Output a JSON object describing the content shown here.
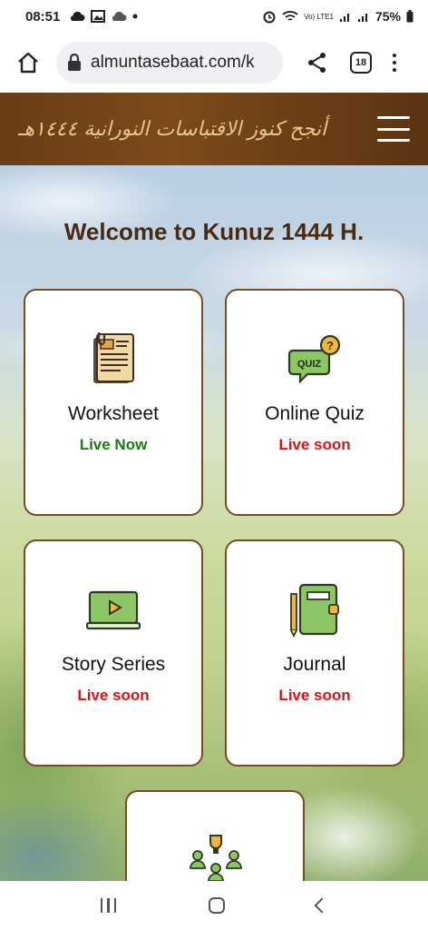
{
  "status_bar": {
    "time": "08:51",
    "battery": "75%",
    "network": "Vo) LTE1",
    "icons": [
      "cloud-icon",
      "image-icon",
      "cloud-icon",
      "dot-icon",
      "alarm-icon",
      "wifi-icon",
      "signal-icon",
      "signal-icon",
      "battery-icon"
    ]
  },
  "browser": {
    "url": "almuntasebaat.com/k",
    "tab_count": "18"
  },
  "site": {
    "logo_text": "أنجح كنوز الاقتباسات النورانية ١٤٤٤هـ",
    "welcome": "Welcome to Kunuz 1444 H."
  },
  "cards": [
    {
      "title": "Worksheet",
      "status": "Live Now",
      "icon": "worksheet-icon"
    },
    {
      "title": "Online Quiz",
      "status": "Live soon",
      "icon": "quiz-icon"
    },
    {
      "title": "Story Series",
      "status": "Live soon",
      "icon": "video-icon"
    },
    {
      "title": "Journal",
      "status": "Live soon",
      "icon": "journal-icon"
    }
  ],
  "colors": {
    "header_brown": "#6a3d17",
    "title_brown": "#4a2a12",
    "live_green": "#1e7a12",
    "soon_red": "#d4161a"
  }
}
